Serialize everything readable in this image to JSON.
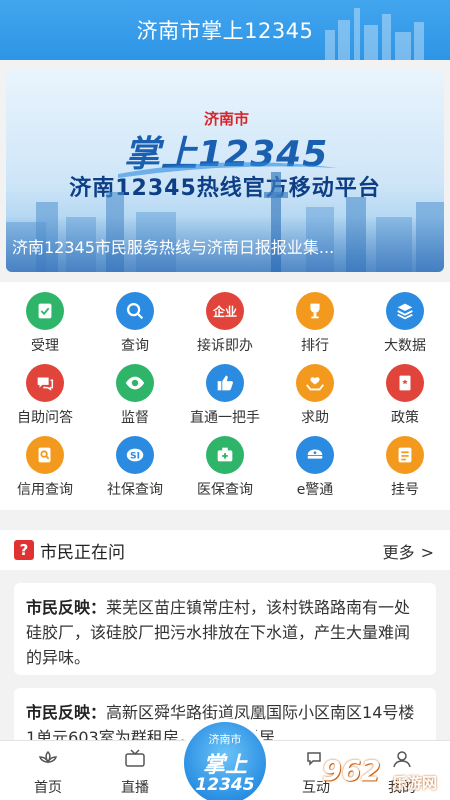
{
  "header": {
    "title": "济南市掌上12345"
  },
  "banner": {
    "logo_city": "济南市",
    "logo_main": "掌上12345",
    "headline": "济南12345热线官方移动平台",
    "caption": "济南12345市民服务热线与济南日报报业集..."
  },
  "services": [
    {
      "label": "受理",
      "icon": "accept-icon",
      "color": "#2fb56a"
    },
    {
      "label": "查询",
      "icon": "search-icon",
      "color": "#2a8be0"
    },
    {
      "label": "接诉即办",
      "icon": "enterprise-icon",
      "color": "#e0443a",
      "badge": "企业"
    },
    {
      "label": "排行",
      "icon": "trophy-icon",
      "color": "#f39a1e"
    },
    {
      "label": "大数据",
      "icon": "layers-icon",
      "color": "#2a8be0"
    },
    {
      "label": "自助问答",
      "icon": "chat-icon",
      "color": "#e0443a"
    },
    {
      "label": "监督",
      "icon": "eye-icon",
      "color": "#2fb56a"
    },
    {
      "label": "直通一把手",
      "icon": "thumbs-up-icon",
      "color": "#2a8be0"
    },
    {
      "label": "求助",
      "icon": "help-hands-icon",
      "color": "#f39a1e"
    },
    {
      "label": "政策",
      "icon": "policy-book-icon",
      "color": "#e0443a"
    },
    {
      "label": "信用查询",
      "icon": "credit-search-icon",
      "color": "#f39a1e"
    },
    {
      "label": "社保查询",
      "icon": "social-security-icon",
      "color": "#2a8be0"
    },
    {
      "label": "医保查询",
      "icon": "medical-kit-icon",
      "color": "#2fb56a"
    },
    {
      "label": "e警通",
      "icon": "police-cap-icon",
      "color": "#2a8be0"
    },
    {
      "label": "挂号",
      "icon": "registration-icon",
      "color": "#f39a1e"
    }
  ],
  "section": {
    "title": "市民正在问",
    "more": "更多",
    "q_mark": "?"
  },
  "posts": [
    {
      "tag": "市民反映：",
      "text": "莱芜区苗庄镇常庄村，该村铁路路南有一处硅胶厂，该硅胶厂把污水排放在下水道，产生大量难闻的异味。"
    },
    {
      "tag": "市民反映：",
      "text": "高新区舜华路街道凤凰国际小区南区14号楼1单元603室为群租房，给整栋楼居"
    }
  ],
  "tabbar": {
    "tabs": [
      {
        "label": "首页",
        "icon": "lotus-home-icon"
      },
      {
        "label": "直播",
        "icon": "live-tv-icon"
      },
      {
        "label": "互动",
        "icon": "interact-icon"
      },
      {
        "label": "我的",
        "icon": "profile-icon"
      }
    ],
    "center": {
      "line1": "济南市",
      "line2": "掌上",
      "line3": "12345"
    }
  },
  "watermark": {
    "logo": "962",
    "text": "乐游网"
  }
}
